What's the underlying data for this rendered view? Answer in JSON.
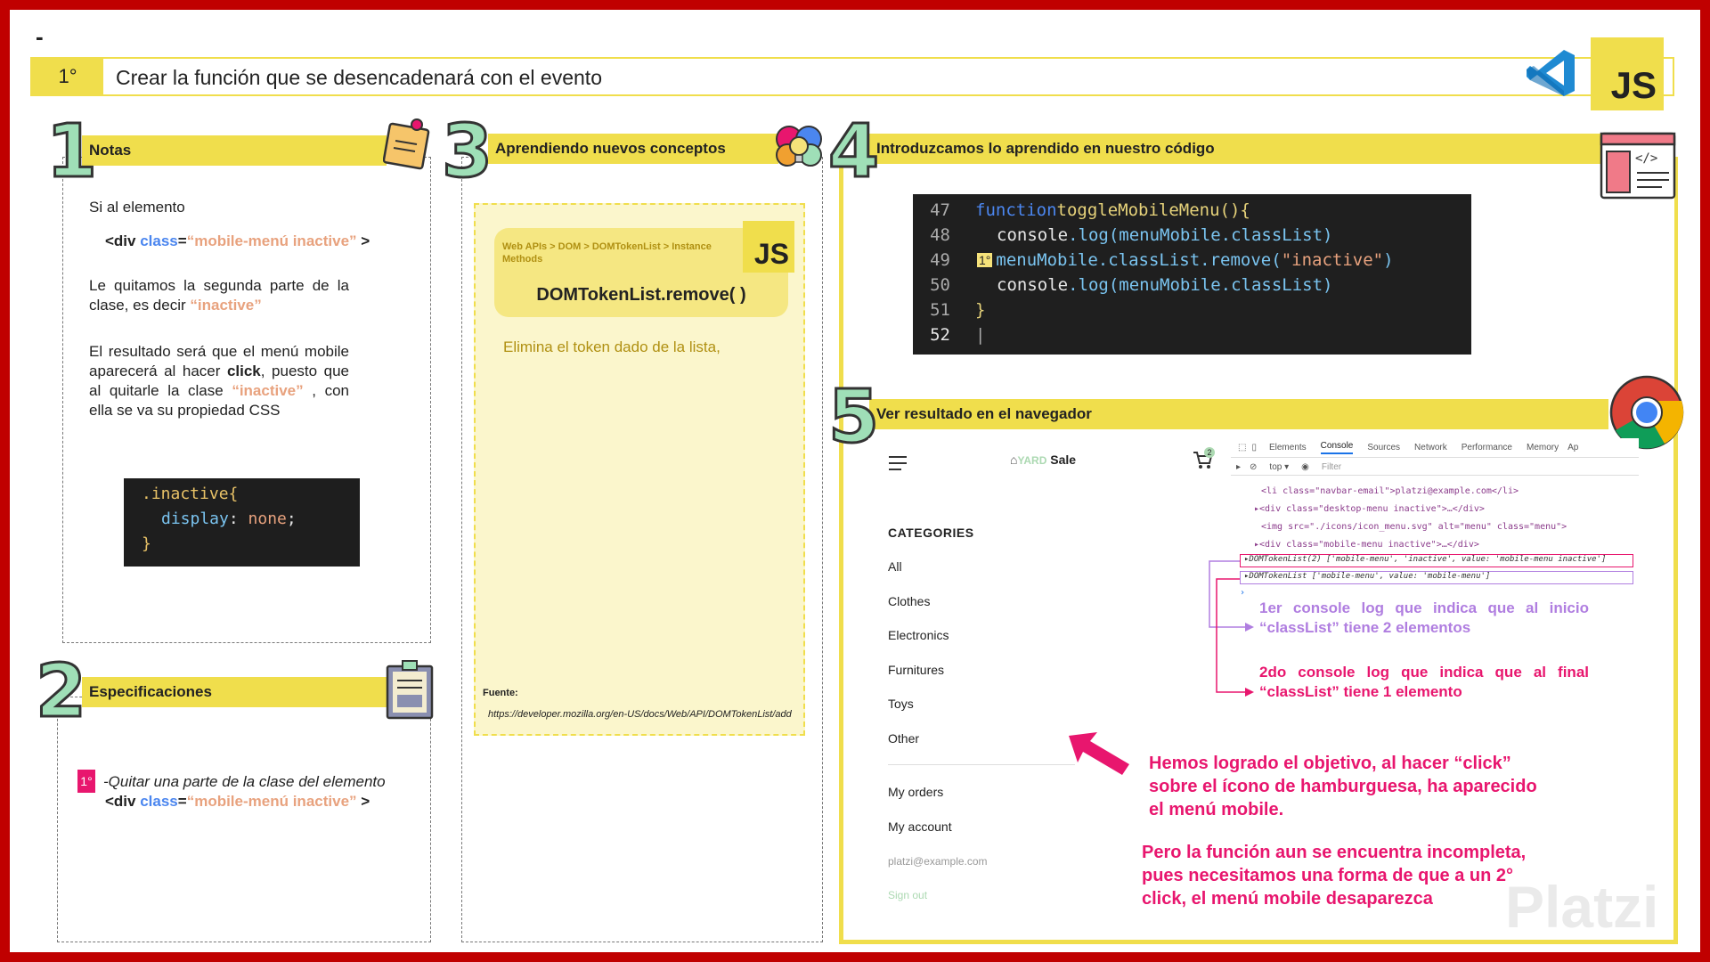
{
  "header": {
    "dash": "-",
    "step": "1°",
    "title": "Crear la función que se desencadenará con el evento",
    "js_badge": "JS"
  },
  "panel1": {
    "number": "1",
    "title": "Notas",
    "intro": "Si al elemento",
    "code_open": "<div ",
    "code_attr": "class",
    "code_eq": "=",
    "code_val": "“mobile-menú inactive”",
    "code_close": " >",
    "p2_text": "Le quitamos la segunda parte de la clase, es decir ",
    "p2_highlight": "“inactive”",
    "p3_a": "El resultado será que el menú mobile aparecerá al hacer ",
    "p3_bold": "click",
    "p3_b": ", puesto que al quitarle la clase ",
    "p3_highlight": "“inactive”",
    "p3_c": " , con ella se va su propiedad CSS",
    "css_selector": ".inactive{",
    "css_prop": "display",
    "css_colon": ": ",
    "css_value": "none",
    "css_semi": ";",
    "css_close": "}"
  },
  "panel2": {
    "number": "2",
    "title": "Especificaciones",
    "badge": "1°",
    "spec": "-Quitar una parte de la clase del elemento",
    "code_open": "<div ",
    "code_attr": "class",
    "code_eq": "=",
    "code_val": "“mobile-menú inactive”",
    "code_close": " >"
  },
  "panel3": {
    "number": "3",
    "title": "Aprendiendo nuevos conceptos",
    "breadcrumb": "Web APIs > DOM > DOMTokenList > Instance Methods",
    "js_badge": "JS",
    "method": "DOMTokenList.remove( )",
    "description": "Elimina el token dado de la lista,",
    "source_label": "Fuente:",
    "source_url": "https://developer.mozilla.org/en-US/docs/Web/API/DOMTokenList/add"
  },
  "panel4": {
    "number": "4",
    "title": "Introduzcamos lo aprendido en nuestro código",
    "marker": "1°",
    "lines": [
      {
        "n": "47",
        "a": "function ",
        "b": "toggleMobileMenu(){"
      },
      {
        "n": "48",
        "a": "console",
        "b": ".log(menuMobile.classList)"
      },
      {
        "n": "49",
        "a": "menuMobile.classList",
        "b": ".remove(",
        "c": "\"inactive\"",
        "d": ")"
      },
      {
        "n": "50",
        "a": "console",
        "b": ".log(menuMobile.classList)"
      },
      {
        "n": "51",
        "a": "}"
      },
      {
        "n": "52",
        "a": "|"
      }
    ]
  },
  "panel5": {
    "number": "5",
    "title": "Ver resultado en el navegador",
    "logo_yard": "YARD",
    "logo_sale": " Sale",
    "cart_count": "2",
    "categories_title": "CATEGORIES",
    "categories": [
      "All",
      "Clothes",
      "Electronics",
      "Furnitures",
      "Toys",
      "Other"
    ],
    "my_orders": "My orders",
    "my_account": "My account",
    "email": "platzi@example.com",
    "sign_out": "Sign out",
    "devtools_tabs": [
      "Elements",
      "Console",
      "Sources",
      "Network",
      "Performance",
      "Memory",
      "Ap"
    ],
    "devtools_context": "top ▾",
    "devtools_filter": "Filter",
    "devtools_lines": [
      "<li class=\"navbar-email\">platzi@example.com</li>",
      "▸<div class=\"desktop-menu inactive\">…</div>",
      "<img src=\"./icons/icon_menu.svg\" alt=\"menu\" class=\"menu\">",
      "▸<div class=\"mobile-menu inactive\">…</div>",
      "▸DOMTokenList(2) ['mobile-menu', 'inactive', value: 'mobile-menu inactive']",
      "▸DOMTokenList ['mobile-menu', value: 'mobile-menu']",
      "›"
    ],
    "note1": "1er console log que indica que al inicio “classList” tiene 2 elementos",
    "note2": "2do console log que indica que al final “classList” tiene 1 elemento",
    "result": "Hemos logrado el objetivo, al hacer “click” sobre el ícono de hamburguesa, ha aparecido el menú mobile.",
    "pending": "Pero la función aun se encuentra incompleta, pues necesitamos una forma de que a un 2° click, el menú mobile desaparezca",
    "watermark": "Platzi"
  },
  "colors": {
    "border": "#c00000",
    "accent_yellow": "#f0de4c",
    "orange": "#e8a27e",
    "purple": "#b07ee0",
    "pink": "#e8166e"
  }
}
